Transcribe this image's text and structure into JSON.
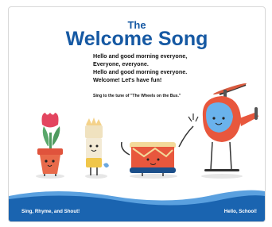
{
  "header": {
    "title_small": "The",
    "title_main": "Welcome Song"
  },
  "lyrics": [
    "Hello and good morning everyone,",
    "Everyone, everyone.",
    "Hello and good morning everyone.",
    "Welcome! Let's have fun!"
  ],
  "note": "Sing to the tune of \"The Wheels on the Bus.\"",
  "footer": {
    "left": "Sing, Rhyme, and Shout!",
    "right": "Hello, School!"
  },
  "colors": {
    "title": "#1659a3",
    "wave": "#1a64b0",
    "wave_light": "#5aa0df"
  },
  "illustration": {
    "characters": [
      "flower-pot-icon",
      "paintbrush-icon",
      "drum-icon",
      "helicopter-icon"
    ]
  }
}
